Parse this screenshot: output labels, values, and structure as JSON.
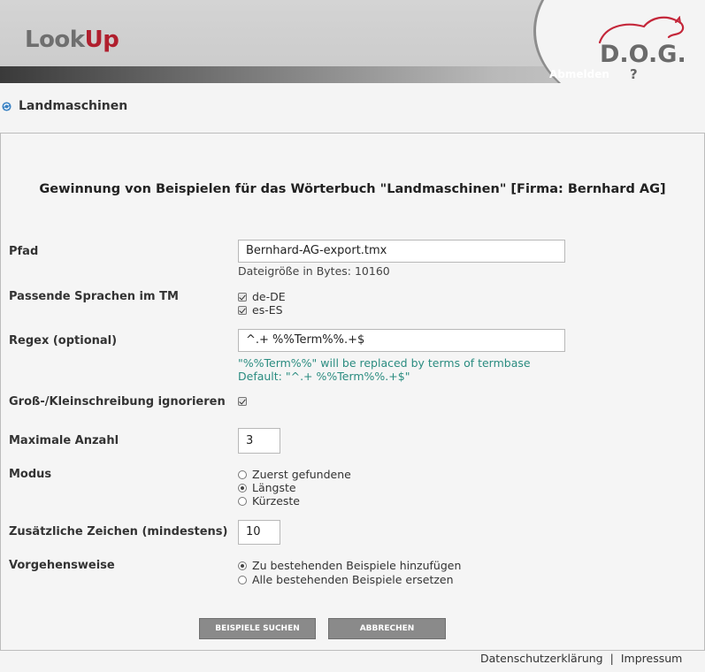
{
  "header": {
    "logo_part1": "Look",
    "logo_part2": "Up",
    "brand_logo": "D.O.G.",
    "logout_label": "Abmelden",
    "help_label": "?"
  },
  "page": {
    "title": "Landmaschinen",
    "title_icon": "refresh-icon"
  },
  "form": {
    "heading": "Gewinnung von Beispielen für das Wörterbuch \"Landmaschinen\" [Firma: Bernhard AG]",
    "path": {
      "label": "Pfad",
      "value": "Bernhard-AG-export.tmx",
      "filesize": "Dateigröße in Bytes: 10160"
    },
    "languages": {
      "label": "Passende Sprachen im TM",
      "options": [
        {
          "label": "de-DE",
          "checked": true
        },
        {
          "label": "es-ES",
          "checked": true
        }
      ]
    },
    "regex": {
      "label": "Regex (optional)",
      "value": "^.+ %%Term%%.+$",
      "hint1": "\"%%Term%%\" will be replaced by terms of termbase",
      "hint2": "Default: \"^.+ %%Term%%.+$\""
    },
    "ignore_case": {
      "label": "Groß-/Kleinschreibung ignorieren",
      "checked": true
    },
    "max_count": {
      "label": "Maximale Anzahl",
      "value": "3"
    },
    "mode": {
      "label": "Modus",
      "options": [
        "Zuerst gefundene",
        "Längste",
        "Kürzeste"
      ],
      "selected": "Längste"
    },
    "extra_chars": {
      "label": "Zusätzliche Zeichen (mindestens)",
      "value": "10"
    },
    "procedure": {
      "label": "Vorgehensweise",
      "options": [
        "Zu bestehenden Beispiele hinzufügen",
        "Alle bestehenden Beispiele ersetzen"
      ],
      "selected": "Zu bestehenden Beispiele hinzufügen"
    },
    "search_button": "BEISPIELE SUCHEN",
    "cancel_button": "ABBRECHEN"
  },
  "footer": {
    "privacy": "Datenschutzerklärung",
    "separator": "|",
    "imprint": "Impressum"
  }
}
